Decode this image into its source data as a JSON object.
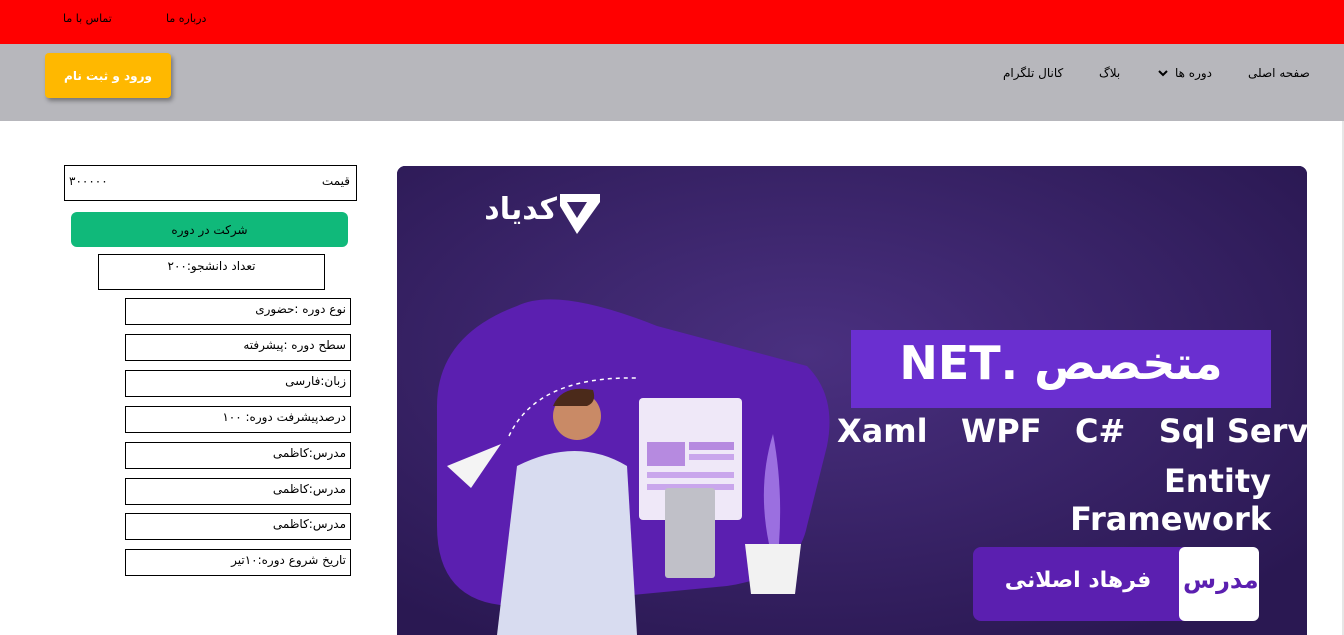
{
  "topbar": {
    "about": "درباره ما",
    "contact": "تماس با ما"
  },
  "nav": {
    "home": "صفحه اصلی",
    "courses": "دوره ها",
    "blog": "بلاگ",
    "telegram": "کانال تلگرام",
    "login": "ورود و ثبت نام"
  },
  "course": {
    "price_label": "قیمت",
    "price_value": "۳۰۰۰۰۰",
    "enroll": "شرکت در دوره",
    "students": "تعداد دانشجو:۲۰۰",
    "details": [
      "نوع دوره :حضوری",
      "سطح دوره :پیشرفته",
      "زبان:فارسی",
      "درصدپیشرفت دوره: ۱۰۰",
      "مدرس:کاظمی",
      "مدرس:کاظمی",
      "مدرس:کاظمی",
      "تاریخ شروع دوره:۱۰تیر"
    ]
  },
  "banner": {
    "brand": "کدیاد",
    "title": "متخصص .NET",
    "tech_line1": "Xaml   WPF   C#   Sql Server",
    "tech_line2": "Entity Framework",
    "teacher_label": "مدرس",
    "teacher_name": "فرهاد اصلانی"
  },
  "colors": {
    "topbar": "#ff0000",
    "navbar": "#b7b7bc",
    "login": "#ffb800",
    "enroll": "#10b97a",
    "banner": "#3a2368"
  }
}
